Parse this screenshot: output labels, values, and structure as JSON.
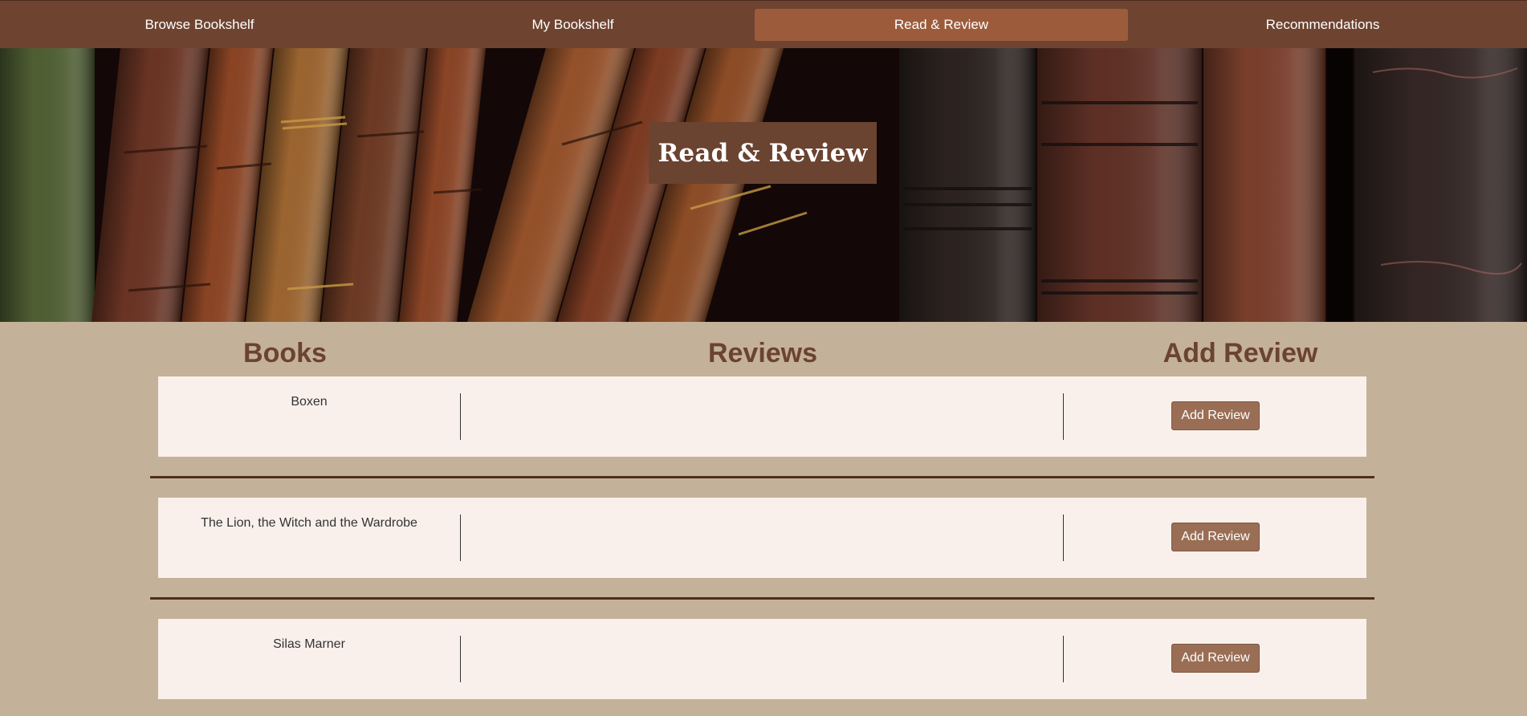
{
  "nav": {
    "items": [
      {
        "label": "Browse Bookshelf",
        "active": false
      },
      {
        "label": "My Bookshelf",
        "active": false
      },
      {
        "label": "Read & Review",
        "active": true
      },
      {
        "label": "Recommendations",
        "active": false
      }
    ]
  },
  "hero": {
    "title": "Read & Review",
    "image": "antique-leather-book-spines"
  },
  "columns": {
    "books": "Books",
    "reviews": "Reviews",
    "add_review": "Add Review"
  },
  "books": [
    {
      "title": "Boxen",
      "review": "",
      "button_label": "Add Review"
    },
    {
      "title": "The Lion, the Witch and the Wardrobe",
      "review": "",
      "button_label": "Add Review"
    },
    {
      "title": "Silas Marner",
      "review": "",
      "button_label": "Add Review"
    }
  ],
  "colors": {
    "nav_bg": "#6e4430",
    "nav_active": "#9c5c3c",
    "page_bg": "#c4b199",
    "heading": "#6b4331",
    "row_bg": "#f9f0eb",
    "button": "#9a6e55",
    "separator": "#4e2e1c"
  }
}
